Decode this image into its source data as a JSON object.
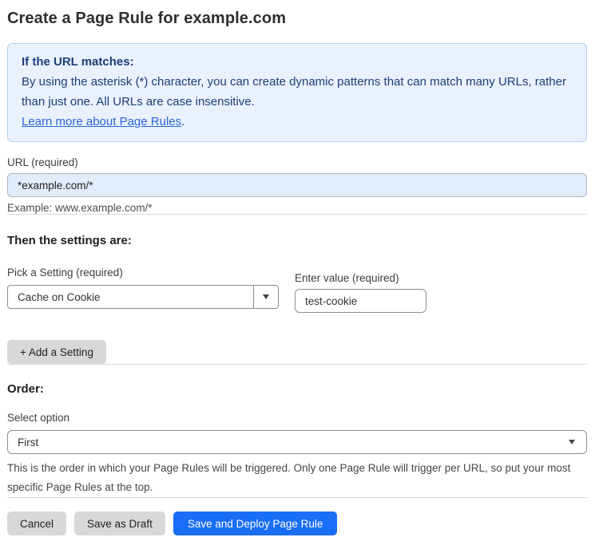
{
  "page": {
    "title": "Create a Page Rule for example.com"
  },
  "info_box": {
    "heading": "If the URL matches:",
    "body": "By using the asterisk (*) character, you can create dynamic patterns that can match many URLs, rather than just one. All URLs are case insensitive.",
    "link_label": "Learn more about Page Rules",
    "link_suffix": "."
  },
  "url_field": {
    "label": "URL (required)",
    "value": "*example.com/*",
    "helper": "Example: www.example.com/*"
  },
  "settings_section": {
    "heading": "Then the settings are:",
    "setting_picker": {
      "label": "Pick a Setting (required)",
      "selected": "Cache on Cookie"
    },
    "value_field": {
      "label": "Enter value (required)",
      "value": "test-cookie"
    },
    "add_setting_label": "+ Add a Setting"
  },
  "order_section": {
    "heading": "Order:",
    "select_label": "Select option",
    "selected": "First",
    "helper": "This is the order in which your Page Rules will be triggered. Only one Page Rule will trigger per URL, so put your most specific Page Rules at the top."
  },
  "footer": {
    "cancel_label": "Cancel",
    "save_draft_label": "Save as Draft",
    "save_deploy_label": "Save and Deploy Page Rule"
  },
  "colors": {
    "accent_blue": "#1a6ef5",
    "info_box_bg": "#e9f1fc",
    "info_box_border": "#b7d0ee",
    "info_box_text": "#1e3d78",
    "link_blue": "#2c64d9",
    "url_input_bg": "#e2edfb",
    "button_gray": "#d8d8d8"
  }
}
